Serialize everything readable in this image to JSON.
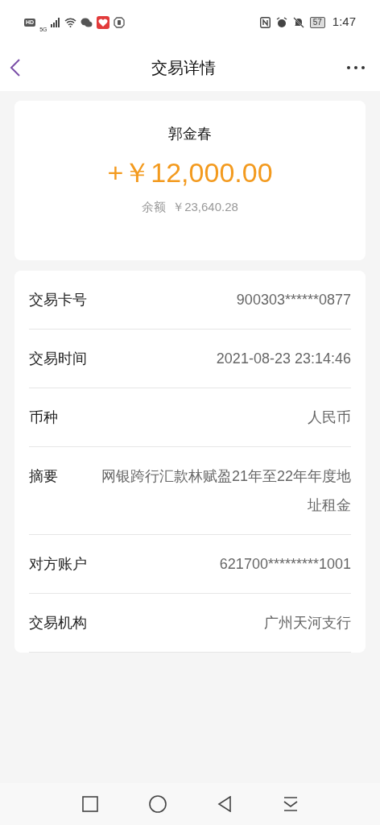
{
  "status_bar": {
    "hd": "HD",
    "network": "5G",
    "battery": "57",
    "time": "1:47"
  },
  "header": {
    "title": "交易详情"
  },
  "summary": {
    "name": "郭金春",
    "amount": "+￥12,000.00",
    "balance_label": "余额",
    "balance": "￥23,640.28"
  },
  "details": [
    {
      "label": "交易卡号",
      "value": "900303******0877"
    },
    {
      "label": "交易时间",
      "value": "2021-08-23 23:14:46"
    },
    {
      "label": "币种",
      "value": "人民币"
    },
    {
      "label": "摘要",
      "value": "网银跨行汇款林赋盈21年至22年年度地址租金"
    },
    {
      "label": "对方账户",
      "value": "621700*********1001"
    },
    {
      "label": "交易机构",
      "value": "广州天河支行"
    }
  ]
}
